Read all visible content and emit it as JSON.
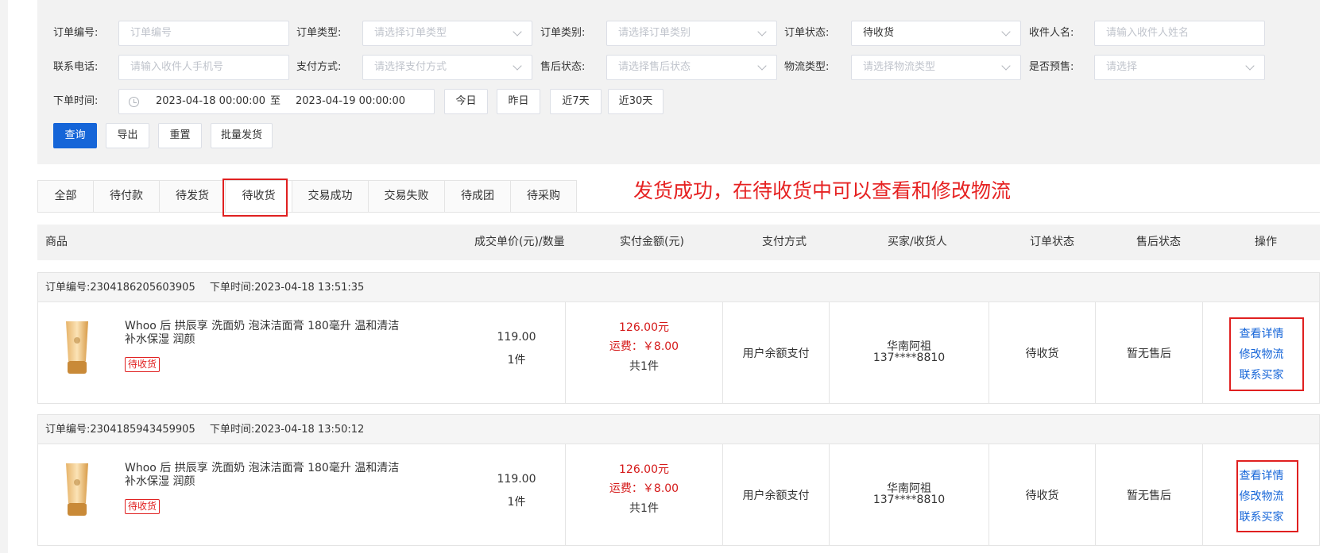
{
  "filters": {
    "order_no": {
      "label": "订单编号:",
      "placeholder": "订单编号"
    },
    "order_type": {
      "label": "订单类型:",
      "placeholder": "请选择订单类型"
    },
    "order_category": {
      "label": "订单类别:",
      "placeholder": "请选择订单类别"
    },
    "order_status": {
      "label": "订单状态:",
      "value": "待收货"
    },
    "receiver_name": {
      "label": "收件人名:",
      "placeholder": "请输入收件人姓名"
    },
    "phone": {
      "label": "联系电话:",
      "placeholder": "请输入收件人手机号"
    },
    "pay_method": {
      "label": "支付方式:",
      "placeholder": "请选择支付方式"
    },
    "after_sale": {
      "label": "售后状态:",
      "placeholder": "请选择售后状态"
    },
    "logistics_type": {
      "label": "物流类型:",
      "placeholder": "请选择物流类型"
    },
    "presale": {
      "label": "是否预售:",
      "placeholder": "请选择"
    },
    "order_time": {
      "label": "下单时间:",
      "start": "2023-04-18 00:00:00",
      "sep": "至",
      "end": "2023-04-19 00:00:00"
    },
    "quick": [
      "今日",
      "昨日",
      "近7天",
      "近30天"
    ],
    "actions": {
      "query": "查询",
      "export": "导出",
      "reset": "重置",
      "batch_ship": "批量发货"
    }
  },
  "tabs": [
    {
      "label": "全部"
    },
    {
      "label": "待付款"
    },
    {
      "label": "待发货"
    },
    {
      "label": "待收货"
    },
    {
      "label": "交易成功"
    },
    {
      "label": "交易失败"
    },
    {
      "label": "待成团"
    },
    {
      "label": "待采购"
    }
  ],
  "annotation": "发货成功，在待收货中可以查看和修改物流",
  "columns": [
    "商品",
    "成交单价(元)/数量",
    "实付金额(元)",
    "支付方式",
    "买家/收货人",
    "订单状态",
    "售后状态",
    "操作"
  ],
  "orders": [
    {
      "order_no": "订单编号:2304186205603905",
      "order_time": "下单时间:2023-04-18 13:51:35",
      "product": "Whoo 后 拱辰享 洗面奶 泡沫洁面膏 180毫升 温和清洁补水保湿 润颜",
      "tag": "待收货",
      "price": "119.00",
      "qty": "1件",
      "paid": "126.00元",
      "freight": "运费：￥8.00",
      "total_items": "共1件",
      "pay_method": "用户余额支付",
      "buyer_name": "华南阿祖",
      "buyer_phone": "137****8810",
      "status": "待收货",
      "after_sale": "暂无售后",
      "ops": [
        "查看详情",
        "修改物流",
        "联系买家"
      ]
    },
    {
      "order_no": "订单编号:2304185943459905",
      "order_time": "下单时间:2023-04-18 13:50:12",
      "product": "Whoo 后 拱辰享 洗面奶 泡沫洁面膏 180毫升 温和清洁补水保湿 润颜",
      "tag": "待收货",
      "price": "119.00",
      "qty": "1件",
      "paid": "126.00元",
      "freight": "运费：￥8.00",
      "total_items": "共1件",
      "pay_method": "用户余额支付",
      "buyer_name": "华南阿祖",
      "buyer_phone": "137****8810",
      "status": "待收货",
      "after_sale": "暂无售后",
      "ops": [
        "查看详情",
        "修改物流",
        "联系买家"
      ]
    }
  ]
}
